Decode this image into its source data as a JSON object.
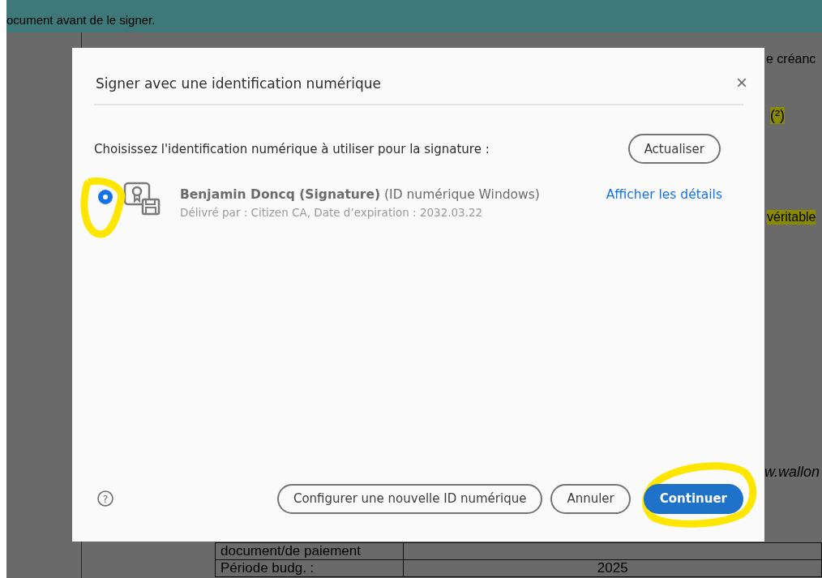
{
  "banner": {
    "message": "ocument avant de le signer."
  },
  "document": {
    "fragments": [
      {
        "kind": "plain",
        "text": "e créanc"
      },
      {
        "kind": "highlight",
        "text": "(²)"
      },
      {
        "kind": "highlight",
        "text": "véritable"
      },
      {
        "kind": "italic",
        "text": "w.wallon"
      }
    ],
    "table_rows": [
      {
        "label": "document/de paiement",
        "value": ""
      },
      {
        "label": "Période budg. :",
        "value": "2025"
      }
    ]
  },
  "dialog": {
    "title": "Signer avec une identification numérique",
    "close": "×",
    "prompt": "Choisissez l'identification numérique à utiliser pour la signature :",
    "refresh_button": "Actualiser",
    "ids": [
      {
        "name": "Benjamin Doncq (Signature)",
        "type": "(ID numérique Windows)",
        "details": "Délivré par : Citizen CA, Date d’expiration : 2032.03.22",
        "link": "Afficher les détails",
        "selected": true
      }
    ],
    "help": "?",
    "buttons": [
      {
        "kind": "secondary",
        "label": "Configurer une nouvelle ID numérique"
      },
      {
        "kind": "secondary",
        "label": "Annuler"
      },
      {
        "kind": "primary",
        "label": "Continuer"
      }
    ]
  }
}
